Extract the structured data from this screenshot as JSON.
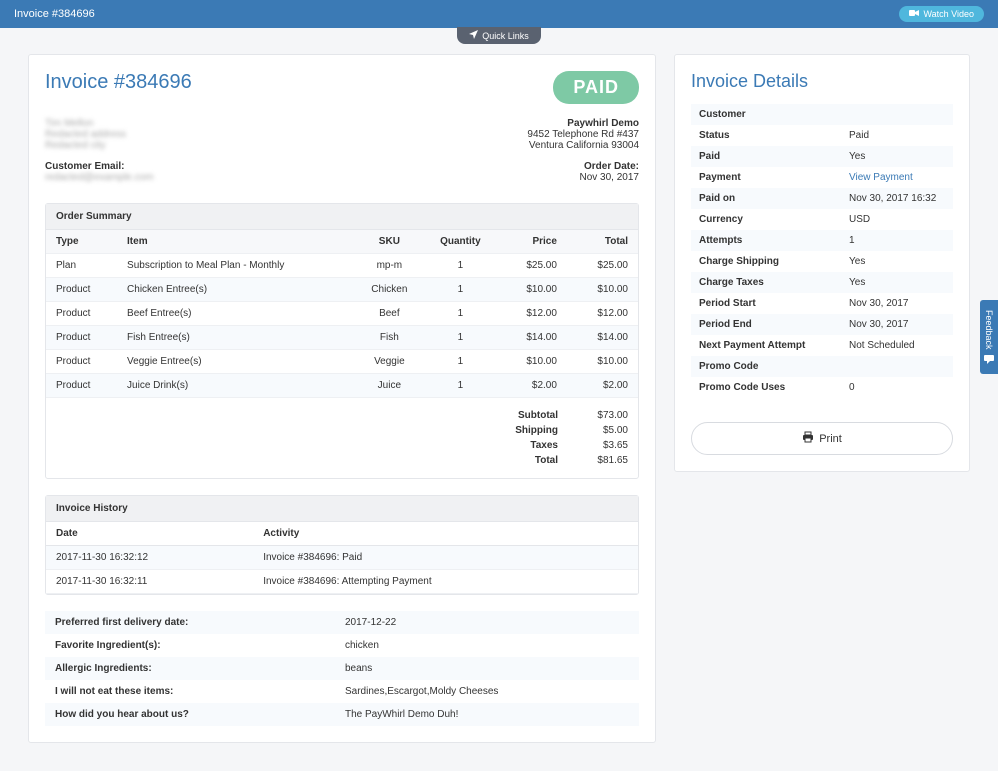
{
  "topbar": {
    "title": "Invoice #384696",
    "watch_video": "Watch Video",
    "quick_links": "Quick Links"
  },
  "invoice": {
    "title": "Invoice #384696",
    "paid_badge": "PAID",
    "customer_email_label": "Customer Email:",
    "company": {
      "name": "Paywhirl Demo",
      "addr1": "9452 Telephone Rd #437",
      "addr2": "Ventura California 93004"
    },
    "order_date_label": "Order Date:",
    "order_date": "Nov 30, 2017"
  },
  "order_summary": {
    "title": "Order Summary",
    "cols": {
      "type": "Type",
      "item": "Item",
      "sku": "SKU",
      "qty": "Quantity",
      "price": "Price",
      "total": "Total"
    },
    "rows": [
      {
        "type": "Plan",
        "item": "Subscription to Meal Plan - Monthly",
        "sku": "mp-m",
        "qty": "1",
        "price": "$25.00",
        "total": "$25.00"
      },
      {
        "type": "Product",
        "item": "Chicken Entree(s)",
        "sku": "Chicken",
        "qty": "1",
        "price": "$10.00",
        "total": "$10.00"
      },
      {
        "type": "Product",
        "item": "Beef Entree(s)",
        "sku": "Beef",
        "qty": "1",
        "price": "$12.00",
        "total": "$12.00"
      },
      {
        "type": "Product",
        "item": "Fish Entree(s)",
        "sku": "Fish",
        "qty": "1",
        "price": "$14.00",
        "total": "$14.00"
      },
      {
        "type": "Product",
        "item": "Veggie Entree(s)",
        "sku": "Veggie",
        "qty": "1",
        "price": "$10.00",
        "total": "$10.00"
      },
      {
        "type": "Product",
        "item": "Juice Drink(s)",
        "sku": "Juice",
        "qty": "1",
        "price": "$2.00",
        "total": "$2.00"
      }
    ],
    "totals": {
      "subtotal_label": "Subtotal",
      "subtotal": "$73.00",
      "shipping_label": "Shipping",
      "shipping": "$5.00",
      "taxes_label": "Taxes",
      "taxes": "$3.65",
      "total_label": "Total",
      "total": "$81.65"
    }
  },
  "history": {
    "title": "Invoice History",
    "cols": {
      "date": "Date",
      "activity": "Activity"
    },
    "rows": [
      {
        "date": "2017-11-30 16:32:12",
        "activity": "Invoice #384696: Paid"
      },
      {
        "date": "2017-11-30 16:32:11",
        "activity": "Invoice #384696: Attempting Payment"
      }
    ]
  },
  "custom_fields": [
    {
      "q": "Preferred first delivery date:",
      "a": "2017-12-22"
    },
    {
      "q": "Favorite Ingredient(s):",
      "a": "chicken"
    },
    {
      "q": "Allergic Ingredients:",
      "a": "beans"
    },
    {
      "q": "I will not eat these items:",
      "a": "Sardines,Escargot,Moldy Cheeses"
    },
    {
      "q": "How did you hear about us?",
      "a": "The PayWhirl Demo Duh!"
    }
  ],
  "details": {
    "title": "Invoice Details",
    "rows": [
      {
        "k": "Customer",
        "v": "",
        "link": true
      },
      {
        "k": "Status",
        "v": "Paid"
      },
      {
        "k": "Paid",
        "v": "Yes"
      },
      {
        "k": "Payment",
        "v": "View Payment",
        "link": true
      },
      {
        "k": "Paid on",
        "v": "Nov 30, 2017 16:32"
      },
      {
        "k": "Currency",
        "v": "USD"
      },
      {
        "k": "Attempts",
        "v": "1"
      },
      {
        "k": "Charge Shipping",
        "v": "Yes"
      },
      {
        "k": "Charge Taxes",
        "v": "Yes"
      },
      {
        "k": "Period Start",
        "v": "Nov 30, 2017"
      },
      {
        "k": "Period End",
        "v": "Nov 30, 2017"
      },
      {
        "k": "Next Payment Attempt",
        "v": "Not Scheduled"
      },
      {
        "k": "Promo Code",
        "v": ""
      },
      {
        "k": "Promo Code Uses",
        "v": "0"
      }
    ],
    "print": "Print"
  },
  "feedback": "Feedback"
}
